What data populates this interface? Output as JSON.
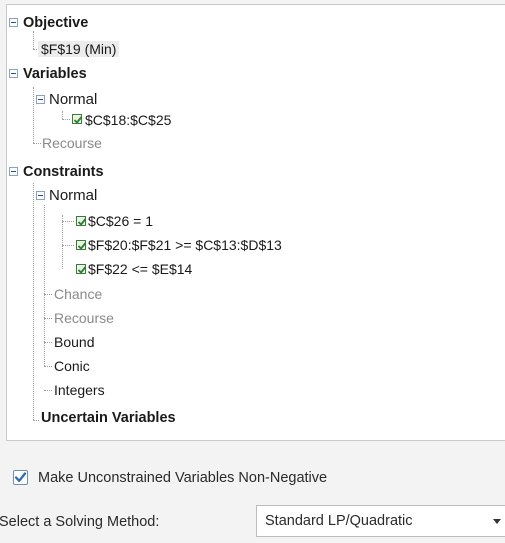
{
  "tree": {
    "objective": {
      "label": "Objective",
      "cell": "$F$19 (Min)"
    },
    "variables": {
      "label": "Variables",
      "normal": {
        "label": "Normal",
        "items": [
          "$C$18:$C$25"
        ]
      },
      "recourse": "Recourse"
    },
    "constraints": {
      "label": "Constraints",
      "normal": {
        "label": "Normal",
        "items": [
          "$C$26 = 1",
          "$F$20:$F$21 >= $C$13:$D$13",
          "$F$22 <= $E$14"
        ]
      },
      "chance": "Chance",
      "recourse": "Recourse",
      "bound": "Bound",
      "conic": "Conic",
      "integers": "Integers"
    },
    "uncertain": "Uncertain Variables"
  },
  "options": {
    "nonneg_label": "Make Unconstrained Variables Non-Negative",
    "nonneg_checked": true
  },
  "solver": {
    "label": "Select a Solving Method:",
    "selected": "Standard LP/Quadratic"
  },
  "colors": {
    "checkbox_accent": "#2b6cb0",
    "tree_check_green": "#2e7d32",
    "disabled_text": "#8a8a8a"
  }
}
